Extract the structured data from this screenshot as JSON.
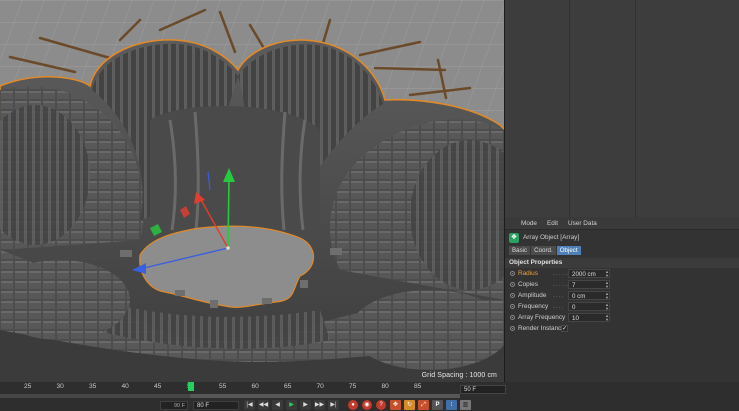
{
  "viewport": {
    "grid_spacing": "Grid Spacing : 1000 cm"
  },
  "attribute_manager": {
    "menu": [
      "Mode",
      "Edit",
      "User Data"
    ],
    "object_title": "Array Object [Array]",
    "tabs": [
      {
        "label": "Basic",
        "active": false
      },
      {
        "label": "Coord.",
        "active": false
      },
      {
        "label": "Object",
        "active": true
      }
    ],
    "section_title": "Object Properties",
    "properties": [
      {
        "label": "Radius",
        "leader": ".........",
        "value": "2000 cm",
        "type": "number",
        "highlight": true
      },
      {
        "label": "Copies",
        "leader": "........",
        "value": "7",
        "type": "number",
        "highlight": false
      },
      {
        "label": "Amplitude",
        "leader": "....",
        "value": "0 cm",
        "type": "number",
        "highlight": false
      },
      {
        "label": "Frequency",
        "leader": "....",
        "value": "0",
        "type": "number",
        "highlight": false
      },
      {
        "label": "Array Frequency",
        "leader": "",
        "value": "10",
        "type": "number",
        "highlight": false
      },
      {
        "label": "Render Instances",
        "leader": "",
        "value": "✓",
        "type": "checkbox",
        "checked": true,
        "highlight": false
      }
    ]
  },
  "timeline": {
    "ruler_labels": [
      "25",
      "30",
      "35",
      "40",
      "45",
      "50",
      "55",
      "60",
      "65",
      "70",
      "75",
      "80",
      "85"
    ],
    "current_frame_marker": "50",
    "end_frame_field": "50 F",
    "start_frame_field": "90 F",
    "max_frame_field": "80 F",
    "transport_icons": [
      "go-to-start-icon",
      "prev-key-icon",
      "prev-frame-icon",
      "play-icon",
      "next-frame-icon",
      "next-key-icon",
      "go-to-end-icon"
    ],
    "record_icons": [
      "record-icon",
      "autokey-icon",
      "keyframe-selection-icon",
      "move-key-icon",
      "rotate-key-icon",
      "scale-key-icon",
      "param-key-icon",
      "point-level-icon",
      "film-icon"
    ],
    "icon_glyphs": {
      "go-to-start-icon": "|◀",
      "prev-key-icon": "◀◀",
      "prev-frame-icon": "◀",
      "play-icon": "▶",
      "next-frame-icon": "▶",
      "next-key-icon": "▶▶",
      "go-to-end-icon": "▶|",
      "record-icon": "●",
      "autokey-icon": "◉",
      "keyframe-selection-icon": "?",
      "move-key-icon": "✥",
      "rotate-key-icon": "↻",
      "scale-key-icon": "⤢",
      "param-key-icon": "P",
      "point-level-icon": "⁝",
      "film-icon": "▥"
    }
  },
  "colors": {
    "selection_outline": "#e08a2a",
    "axis_x": "#e23d2d",
    "axis_y": "#27c93f",
    "axis_z": "#3a5fe0",
    "active_tab": "#4f7fb7",
    "highlight_label": "#f0a23c",
    "playhead": "#24d05c"
  }
}
